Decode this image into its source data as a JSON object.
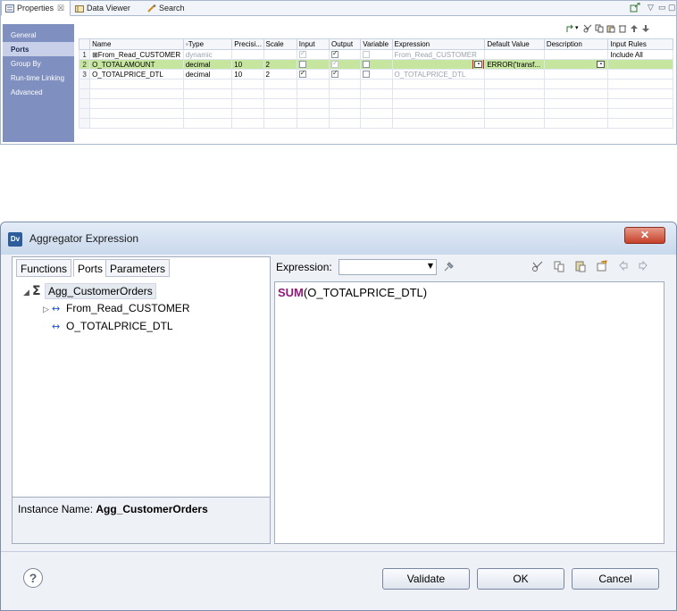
{
  "properties_panel": {
    "tabs": [
      {
        "label": "Properties",
        "close": "☒",
        "icon": "properties-icon"
      },
      {
        "label": "Data Viewer",
        "icon": "data-viewer-icon"
      },
      {
        "label": "Search",
        "icon": "search-icon"
      }
    ],
    "sidebar": [
      "General",
      "Ports",
      "Group By",
      "Run-time Linking",
      "Advanced"
    ],
    "selected_sidebar": "Ports",
    "columns": [
      "",
      "Name",
      "Type",
      "Precisi...",
      "Scale",
      "Input",
      "Output",
      "Variable",
      "Expression",
      "Default Value",
      "Description",
      "Input Rules"
    ],
    "rows": [
      {
        "num": "1",
        "name": "From_Read_CUSTOMER",
        "prefix": "⊞",
        "type": "dynamic",
        "precision": "",
        "scale": "",
        "input": true,
        "output": true,
        "variable": false,
        "expression": "From_Read_CUSTOMER",
        "default_value": "",
        "description": "",
        "input_rules": "Include All",
        "dim": true
      },
      {
        "num": "2",
        "name": "O_TOTALAMOUNT",
        "prefix": "",
        "type": "decimal",
        "precision": "10",
        "scale": "2",
        "input": false,
        "output": true,
        "variable": false,
        "expression": "",
        "default_value": "ERROR('transf...",
        "description": "",
        "input_rules": "",
        "dim": false,
        "highlighted": true
      },
      {
        "num": "3",
        "name": "O_TOTALPRICE_DTL",
        "prefix": "",
        "type": "decimal",
        "precision": "10",
        "scale": "2",
        "input": true,
        "output": true,
        "variable": false,
        "expression": "O_TOTALPRICE_DTL",
        "default_value": "",
        "description": "",
        "input_rules": "",
        "dim": false
      }
    ]
  },
  "dialog": {
    "title": "Aggregator Expression",
    "logo_text": "Dv",
    "close_label": "✕",
    "left_tabs": [
      "Functions",
      "Ports",
      "Parameters"
    ],
    "active_left_tab": "Ports",
    "tree": {
      "root": "Agg_CustomerOrders",
      "children": [
        "From_Read_CUSTOMER",
        "O_TOTALPRICE_DTL"
      ]
    },
    "instance_label": "Instance Name:",
    "instance_value": "Agg_CustomerOrders",
    "expression_label": "Expression:",
    "expression_select_value": "",
    "expression_function": "SUM",
    "expression_args": "(O_TOTALPRICE_DTL)",
    "help_label": "?",
    "buttons": {
      "validate": "Validate",
      "ok": "OK",
      "cancel": "Cancel"
    }
  },
  "colors": {
    "highlight_row": "#c6e59f",
    "function_keyword": "#8e1a79",
    "sidebar_bg": "#7f8fbf",
    "port_arrow": "#1f55c6"
  }
}
